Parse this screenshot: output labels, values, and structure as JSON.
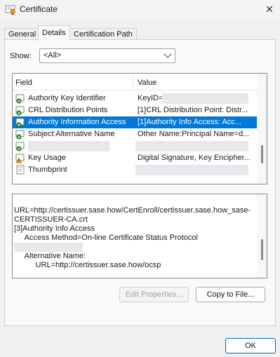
{
  "window": {
    "title": "Certificate",
    "close_glyph": "✕"
  },
  "tabs": [
    {
      "label": "General",
      "active": false
    },
    {
      "label": "Details",
      "active": true
    },
    {
      "label": "Certification Path",
      "active": false
    }
  ],
  "show": {
    "label": "Show:",
    "value": "<All>"
  },
  "list": {
    "columns": {
      "field": "Field",
      "value": "Value"
    },
    "rows": [
      {
        "field": "Authority Key Identifier",
        "value": "KeyID=",
        "icon": "cert-extension-icon",
        "selected": false
      },
      {
        "field": "CRL Distribution Points",
        "value": "[1]CRL Distribution Point: Distr...",
        "icon": "cert-extension-icon",
        "selected": false
      },
      {
        "field": "Authority Information Access",
        "value": "[1]Authority Info Access: Acc...",
        "icon": "cert-extension-icon",
        "selected": true
      },
      {
        "field": "Subject Alternative Name",
        "value": "Other Name:Principal Name=d...",
        "icon": "cert-extension-icon",
        "selected": false
      },
      {
        "field": "",
        "value": "",
        "icon": "cert-extension-icon",
        "selected": false
      },
      {
        "field": "Key Usage",
        "value": "Digital Signature, Key Encipher...",
        "icon": "warning-extension-icon",
        "selected": false
      },
      {
        "field": "Thumbprint",
        "value": "",
        "icon": "thumbprint-icon",
        "selected": false
      }
    ]
  },
  "details": {
    "lines": [
      "URL=http://certissuer.sase.how/CertEnroll/certissuer.sase.how_sase-",
      "CERTISSUER-CA.crt",
      "[3]Authority Info Access",
      "     Access Method=On-line Certificate Status Protocol",
      "",
      "     Alternative Name:",
      "          URL=http://certissuer.sase.how/ocsp"
    ]
  },
  "buttons": {
    "edit_properties": "Edit Properties...",
    "copy_to_file": "Copy to File...",
    "ok": "OK"
  },
  "colors": {
    "selection": "#0078d7",
    "accent": "#0067c0"
  }
}
